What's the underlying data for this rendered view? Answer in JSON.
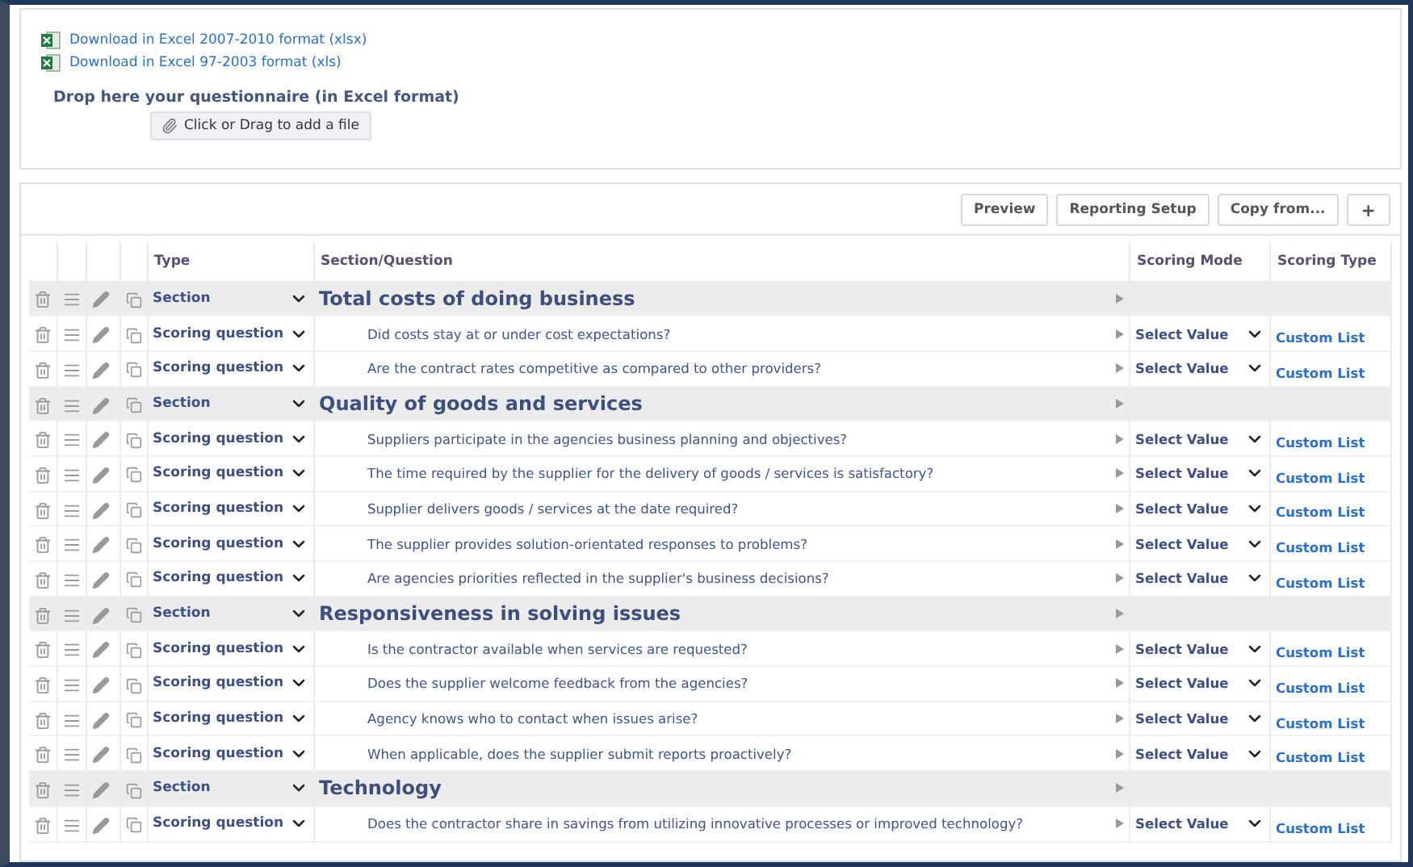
{
  "downloads": [
    {
      "label": "Download in Excel 2007-2010 format (xlsx)"
    },
    {
      "label": "Download in Excel 97-2003 format (xls)"
    }
  ],
  "drop_zone": {
    "title": "Drop here your questionnaire (in Excel format)",
    "button": "Click or Drag to add a file"
  },
  "toolbar": {
    "buttons": [
      "Preview",
      "Reporting Setup",
      "Copy from..."
    ],
    "add_button": "+"
  },
  "table": {
    "columns": [
      "Type",
      "Section/Question",
      "Scoring Mode",
      "Scoring Type"
    ],
    "rows": [
      {
        "kind": "section",
        "type": "Section",
        "text": "Total costs of doing business"
      },
      {
        "kind": "question",
        "type": "Scoring question",
        "text": "Did costs stay at or under cost expectations?",
        "scoring_mode": "Select Value",
        "scoring_type": "Custom List"
      },
      {
        "kind": "question",
        "type": "Scoring question",
        "text": "Are the contract rates competitive as compared to other providers?",
        "scoring_mode": "Select Value",
        "scoring_type": "Custom List"
      },
      {
        "kind": "section",
        "type": "Section",
        "text": "Quality of goods and services"
      },
      {
        "kind": "question",
        "type": "Scoring question",
        "text": "Suppliers participate in the agencies business planning and objectives?",
        "scoring_mode": "Select Value",
        "scoring_type": "Custom List"
      },
      {
        "kind": "question",
        "type": "Scoring question",
        "text": "The time required by the supplier for the delivery of goods / services is satisfactory?",
        "scoring_mode": "Select Value",
        "scoring_type": "Custom List"
      },
      {
        "kind": "question",
        "type": "Scoring question",
        "text": "Supplier delivers goods / services at the date required?",
        "scoring_mode": "Select Value",
        "scoring_type": "Custom List"
      },
      {
        "kind": "question",
        "type": "Scoring question",
        "text": "The supplier provides solution-orientated responses to problems?",
        "scoring_mode": "Select Value",
        "scoring_type": "Custom List"
      },
      {
        "kind": "question",
        "type": "Scoring question",
        "text": "Are agencies priorities reflected in the supplier's business decisions?",
        "scoring_mode": "Select Value",
        "scoring_type": "Custom List"
      },
      {
        "kind": "section",
        "type": "Section",
        "text": "Responsiveness in solving issues"
      },
      {
        "kind": "question",
        "type": "Scoring question",
        "text": "Is the contractor available when services are requested?",
        "scoring_mode": "Select Value",
        "scoring_type": "Custom List"
      },
      {
        "kind": "question",
        "type": "Scoring question",
        "text": "Does the supplier welcome feedback from the agencies?",
        "scoring_mode": "Select Value",
        "scoring_type": "Custom List"
      },
      {
        "kind": "question",
        "type": "Scoring question",
        "text": "Agency knows who to contact when issues arise?",
        "scoring_mode": "Select Value",
        "scoring_type": "Custom List"
      },
      {
        "kind": "question",
        "type": "Scoring question",
        "text": "When applicable, does the supplier submit reports proactively?",
        "scoring_mode": "Select Value",
        "scoring_type": "Custom List"
      },
      {
        "kind": "section",
        "type": "Section",
        "text": "Technology"
      },
      {
        "kind": "question",
        "type": "Scoring question",
        "text": "Does the contractor share in savings from utilizing innovative processes or improved technology?",
        "scoring_mode": "Select Value",
        "scoring_type": "Custom List"
      }
    ]
  }
}
